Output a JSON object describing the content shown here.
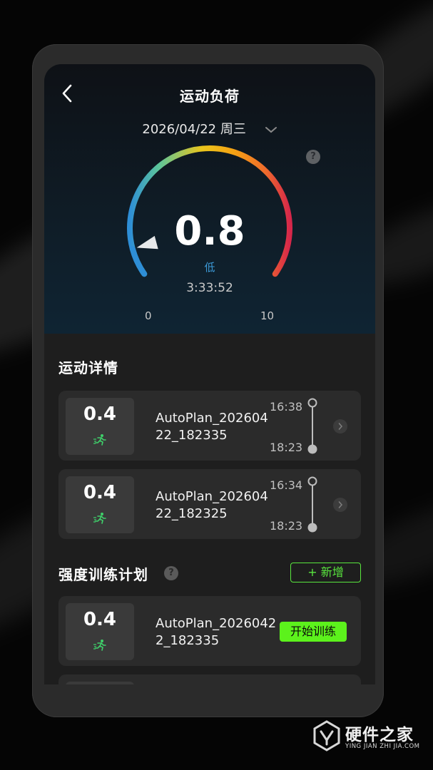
{
  "header": {
    "title": "运动负荷",
    "date": "2026/04/22 周三",
    "help_icon": "?"
  },
  "gauge": {
    "value": "0.8",
    "level": "低",
    "duration": "3:33:52",
    "min": "0",
    "max": "10",
    "min_value": 0,
    "max_value": 10,
    "current": 0.8,
    "gradient_colors": [
      "#2e8ed6",
      "#5cc59a",
      "#e9c51c",
      "#f5a213",
      "#ef6b2c",
      "#d6274a"
    ]
  },
  "details": {
    "title": "运动详情",
    "items": [
      {
        "score": "0.4",
        "name": "AutoPlan_20260422_182335",
        "start": "16:38",
        "end": "18:23",
        "icon": "running-person-icon"
      },
      {
        "score": "0.4",
        "name": "AutoPlan_20260422_182325",
        "start": "16:34",
        "end": "18:23",
        "icon": "running-person-icon"
      }
    ]
  },
  "plans": {
    "title": "强度训练计划",
    "help_icon": "?",
    "add_label": "+ 新增",
    "items": [
      {
        "score": "0.4",
        "name": "AutoPlan_20260422_182335",
        "action": "开始训练",
        "icon": "running-person-icon"
      }
    ]
  },
  "watermark": {
    "text": "硬件之家",
    "sub": "YING JIAN ZHI JIA.COM"
  },
  "colors": {
    "accent_green": "#5cf21c",
    "level_blue": "#3d9bd9",
    "card_bg": "#2b2b2b"
  }
}
